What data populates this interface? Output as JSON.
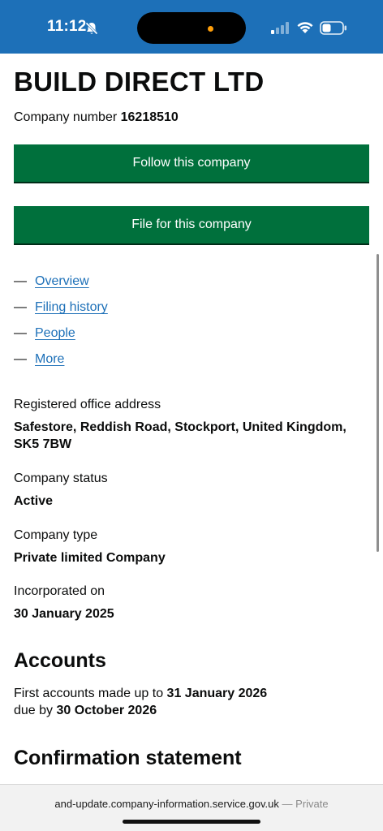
{
  "status_bar": {
    "time": "11:12",
    "colors": {
      "background": "#1d70b8",
      "island_dot": "#ff9f0a"
    },
    "icons": [
      "bell-muted-icon",
      "cellular-signal-icon",
      "wifi-icon",
      "battery-icon"
    ]
  },
  "company": {
    "name": "BUILD DIRECT LTD",
    "number_label": "Company number",
    "number": "16218510"
  },
  "buttons": {
    "follow": "Follow this company",
    "file": "File for this company",
    "color": "#00703c"
  },
  "nav": {
    "dash": "—",
    "items": [
      {
        "label": "Overview"
      },
      {
        "label": "Filing history"
      },
      {
        "label": "People"
      },
      {
        "label": "More"
      }
    ],
    "link_color": "#1d70b8"
  },
  "details": {
    "address_label": "Registered office address",
    "address_value": "Safestore, Reddish Road, Stockport, United Kingdom, SK5 7BW",
    "status_label": "Company status",
    "status_value": "Active",
    "type_label": "Company type",
    "type_value": "Private limited Company",
    "incorporated_label": "Incorporated on",
    "incorporated_value": "30 January 2025"
  },
  "accounts": {
    "heading": "Accounts",
    "first_prefix": "First accounts made up to",
    "first_date": "31 January 2026",
    "due_prefix": "due by",
    "due_date": "30 October 2026"
  },
  "confirmation": {
    "heading": "Confirmation statement"
  },
  "browser": {
    "url": "and-update.company-information.service.gov.uk",
    "separator": "—",
    "mode": "Private"
  }
}
